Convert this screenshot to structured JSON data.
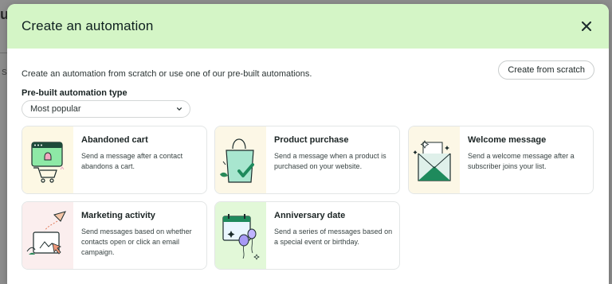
{
  "backdrop": {
    "title_fragment": "ut",
    "side_letter": "S",
    "tab_fragment": "C"
  },
  "modal": {
    "title": "Create an automation",
    "close_icon": "close-icon",
    "intro": "Create an automation from scratch or use one of our pre-built automations.",
    "scratch_button": "Create from scratch",
    "type_label": "Pre-built automation type",
    "type_select": {
      "value": "Most popular"
    }
  },
  "cards": [
    {
      "title": "Abandoned cart",
      "desc": "Send a message after a contact abandons a cart.",
      "icon": "shopping-cart-illustration"
    },
    {
      "title": "Product purchase",
      "desc": "Send a message when a product is purchased on your website.",
      "icon": "shopping-bag-illustration"
    },
    {
      "title": "Welcome message",
      "desc": "Send a welcome message after a subscriber joins your list.",
      "icon": "envelope-illustration"
    },
    {
      "title": "Marketing activity",
      "desc": "Send messages based on whether contacts open or click an email campaign.",
      "icon": "paper-plane-illustration"
    },
    {
      "title": "Anniversary date",
      "desc": "Send a series of messages based on a special event or birthday.",
      "icon": "calendar-balloon-illustration"
    }
  ],
  "colors": {
    "header_bg": "#d4f5c6",
    "accent_green": "#1e8a5c",
    "text_dark": "#1b2424"
  }
}
